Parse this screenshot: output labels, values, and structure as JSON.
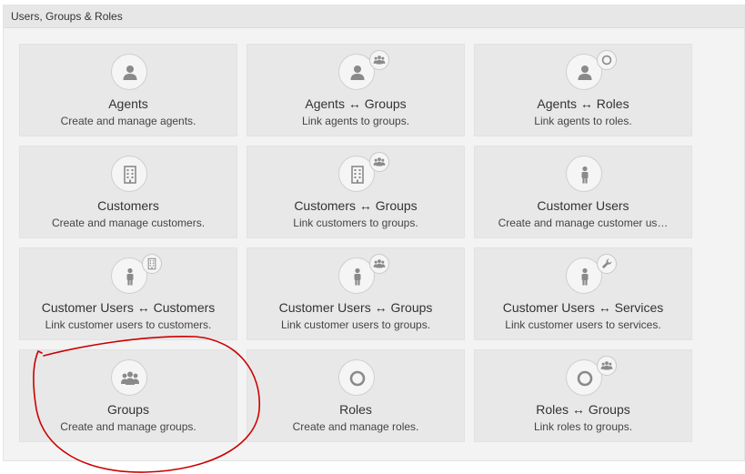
{
  "panel": {
    "title": "Users, Groups & Roles"
  },
  "tiles": [
    {
      "title": "Agents",
      "desc": "Create and manage agents.",
      "icon": "agent-icon",
      "badge": null
    },
    {
      "title": "Agents ↔ Groups",
      "desc": "Link agents to groups.",
      "icon": "agent-icon",
      "badge": "group-icon"
    },
    {
      "title": "Agents ↔ Roles",
      "desc": "Link agents to roles.",
      "icon": "agent-icon",
      "badge": "role-icon"
    },
    {
      "title": "Customers",
      "desc": "Create and manage customers.",
      "icon": "building-icon",
      "badge": null
    },
    {
      "title": "Customers ↔ Groups",
      "desc": "Link customers to groups.",
      "icon": "building-icon",
      "badge": "group-icon"
    },
    {
      "title": "Customer Users",
      "desc": "Create and manage customer us…",
      "icon": "customer-user-icon",
      "badge": null
    },
    {
      "title": "Customer Users ↔ Customers",
      "desc": "Link customer users to customers.",
      "icon": "customer-user-icon",
      "badge": "building-icon"
    },
    {
      "title": "Customer Users ↔ Groups",
      "desc": "Link customer users to groups.",
      "icon": "customer-user-icon",
      "badge": "group-icon"
    },
    {
      "title": "Customer Users ↔ Services",
      "desc": "Link customer users to services.",
      "icon": "customer-user-icon",
      "badge": "wrench-icon"
    },
    {
      "title": "Groups",
      "desc": "Create and manage groups.",
      "icon": "group-icon",
      "badge": null
    },
    {
      "title": "Roles",
      "desc": "Create and manage roles.",
      "icon": "role-icon",
      "badge": null
    },
    {
      "title": "Roles ↔ Groups",
      "desc": "Link roles to groups.",
      "icon": "role-icon",
      "badge": "group-icon"
    }
  ],
  "colors": {
    "icon": "#8a8a8a",
    "annotation": "#cc0000",
    "tile_bg": "#e8e8e8",
    "panel_bg": "#f3f3f3"
  }
}
